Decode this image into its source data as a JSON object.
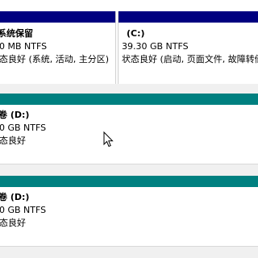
{
  "disk_row_1": {
    "partitions": [
      {
        "name": "系统保留",
        "size_fs": "0 MB NTFS",
        "status": "态良好 (系统, 活动, 主分区)"
      },
      {
        "name": "(C:)",
        "size_fs": "39.30 GB NTFS",
        "status": "状态良好 (启动, 页面文件, 故障转储"
      }
    ]
  },
  "disk_row_2": {
    "partition": {
      "name": "卷 (D:)",
      "size_fs": "0 GB NTFS",
      "status": "态良好"
    }
  },
  "disk_row_3": {
    "partition": {
      "name": "卷 (D:)",
      "size_fs": "0 GB NTFS",
      "status": "态良好"
    }
  },
  "colors": {
    "primary_partition_bar": "#000080",
    "logical_volume_bar": "#008080",
    "gap": "#f0f0f0"
  }
}
